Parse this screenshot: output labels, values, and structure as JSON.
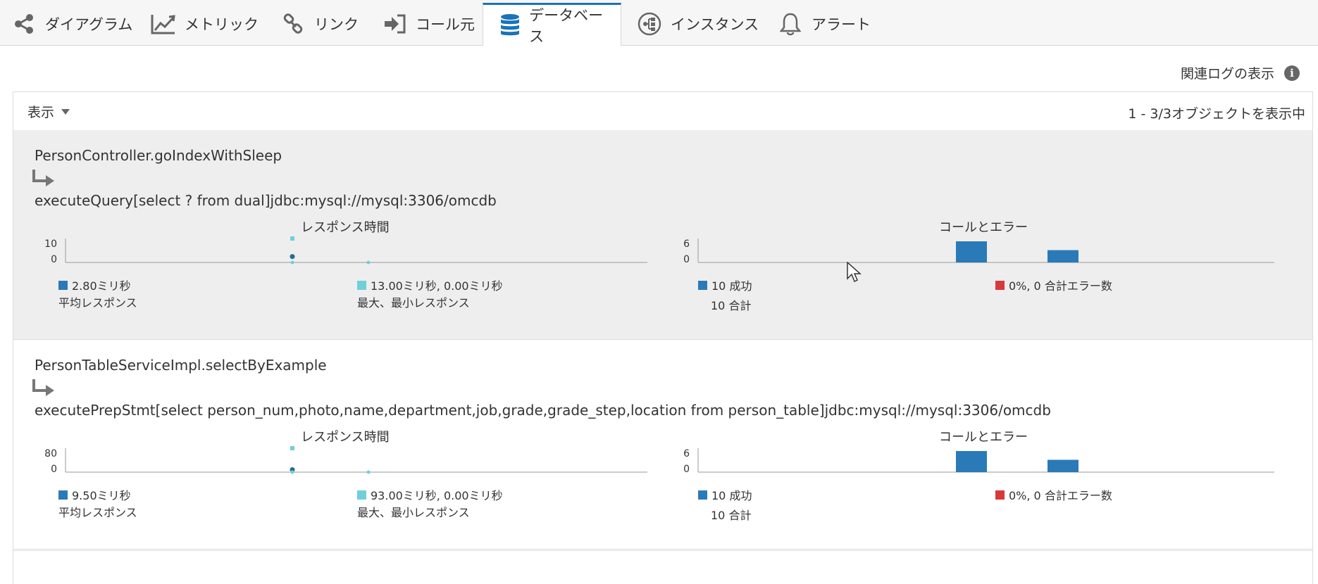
{
  "tabs": [
    {
      "label": "ダイアグラム",
      "icon": "share-icon"
    },
    {
      "label": "メトリック",
      "icon": "line-chart-icon"
    },
    {
      "label": "リンク",
      "icon": "link-icon"
    },
    {
      "label": "コール元",
      "icon": "sign-in-icon"
    },
    {
      "label": "データベース",
      "icon": "database-icon",
      "active": true
    },
    {
      "label": "インスタンス",
      "icon": "instance-icon"
    },
    {
      "label": "アラート",
      "icon": "bell-icon"
    }
  ],
  "related_log": "関連ログの表示",
  "view_label": "表示",
  "object_count": "1 - 3/3オブジェクトを表示中",
  "accent_color": "#1a73b8",
  "rows": [
    {
      "caller": "PersonController.goIndexWithSleep",
      "query": "executeQuery[select ? from dual]jdbc:mysql://mysql:3306/omcdb",
      "response_title": "レスポンス時間",
      "calls_title": "コールとエラー",
      "response_axis": [
        "10",
        "0"
      ],
      "calls_axis": [
        "6",
        "0"
      ],
      "avg_value": "2.80ミリ秒",
      "avg_label": "平均レスポンス",
      "maxmin_value": "13.00ミリ秒, 0.00ミリ秒",
      "maxmin_label": "最大、最小レスポンス",
      "success": "10 成功",
      "total": "10 合計",
      "errors": "0%, 0 合計エラー数"
    },
    {
      "caller": "PersonTableServiceImpl.selectByExample",
      "query": "executePrepStmt[select person_num,photo,name,department,job,grade,grade_step,location from person_table]jdbc:mysql://mysql:3306/omcdb",
      "response_title": "レスポンス時間",
      "calls_title": "コールとエラー",
      "response_axis": [
        "80",
        "0"
      ],
      "calls_axis": [
        "6",
        "0"
      ],
      "avg_value": "9.50ミリ秒",
      "avg_label": "平均レスポンス",
      "maxmin_value": "93.00ミリ秒, 0.00ミリ秒",
      "maxmin_label": "最大、最小レスポンス",
      "success": "10 成功",
      "total": "10 合計",
      "errors": "0%, 0 合計エラー数"
    }
  ],
  "colors": {
    "avg": "#2a7ab8",
    "maxmin": "#6fd0d8",
    "success": "#2a7ab8",
    "error": "#d63a3a"
  },
  "chart_data": [
    {
      "type": "scatter",
      "series": [
        {
          "values": [
            2.8
          ]
        },
        {
          "values": [
            13,
            0
          ]
        }
      ],
      "ylim": [
        0,
        10
      ]
    },
    {
      "type": "bar",
      "values": [
        6,
        3.5
      ],
      "ylim": [
        0,
        6
      ]
    },
    {
      "type": "scatter",
      "series": [
        {
          "values": [
            9.5
          ]
        },
        {
          "values": [
            93,
            0
          ]
        }
      ],
      "ylim": [
        0,
        80
      ]
    },
    {
      "type": "bar",
      "values": [
        6,
        3.5
      ],
      "ylim": [
        0,
        6
      ]
    }
  ]
}
